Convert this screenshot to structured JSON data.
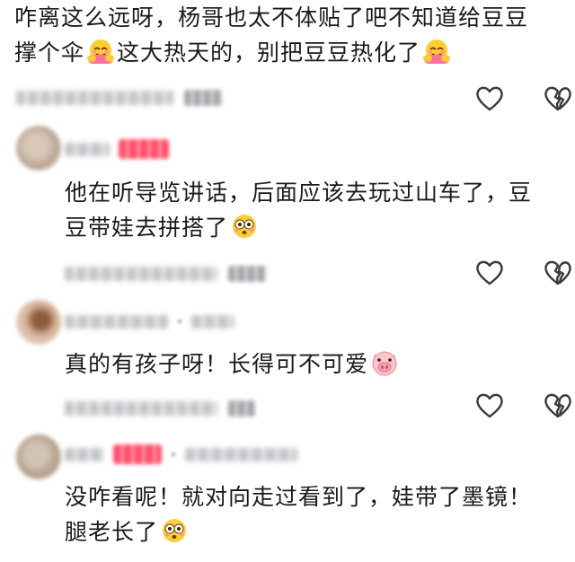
{
  "comments": [
    {
      "line1": "咋离这么远呀，杨哥也太不体贴了吧不知道给豆豆",
      "line2_a": "撑个伞",
      "line2_b": "这大热天的，别把豆豆热化了",
      "emoji": "hugging-face-icon"
    },
    {
      "line1": "他在听导览讲话，后面应该去玩过山车了，豆",
      "line2": "豆带娃去拼搭了",
      "emoji": "flushed-face-icon"
    },
    {
      "line1": "真的有孩子呀！长得可不可爱",
      "emoji": "pig-face-icon"
    },
    {
      "line1": "没咋看呢！就对向走过看到了，娃带了墨镜！",
      "line2": "腿老长了",
      "emoji": "flushed-face-icon"
    }
  ],
  "actions": {
    "like_icon": "heart-outline-icon",
    "dislike_icon": "broken-heart-outline-icon"
  },
  "colors": {
    "text": "#1a1a1a",
    "icon_stroke": "#3a3a3a",
    "badge": "#ff4d6a",
    "blur_gray": "#b9b9bd"
  }
}
